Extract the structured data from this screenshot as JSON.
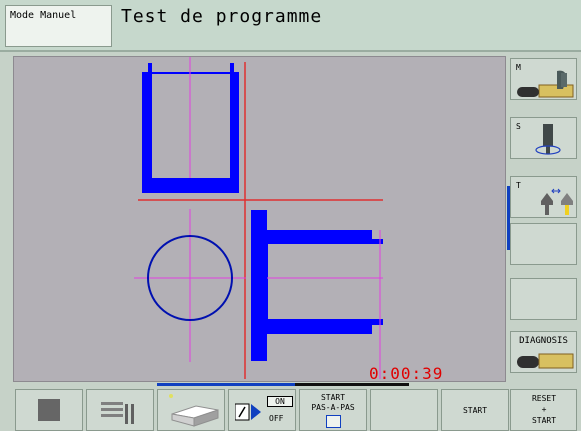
{
  "header": {
    "mode_label": "Mode Manuel",
    "title": "Test de programme"
  },
  "simulation": {
    "timer": "0:00:39"
  },
  "right_softkeys": [
    {
      "letter": "M",
      "icon": "spindle-machine-icon"
    },
    {
      "letter": "S",
      "icon": "spindle-speed-icon"
    },
    {
      "letter": "T",
      "icon": "tool-change-icon"
    },
    {
      "label": ""
    },
    {
      "label": ""
    },
    {
      "label": "DIAGNOSIS",
      "icon": "diagnosis-machine-icon"
    }
  ],
  "bottom_softkeys": {
    "stop_icon": "stop-square-icon",
    "tool_icon": "tool-table-icon",
    "workpiece_icon": "workpiece-block-icon",
    "block_skip": {
      "on_label": "ON",
      "off_label": "OFF",
      "icon": "block-skip-icon"
    },
    "start_single_line1": "START",
    "start_single_line2": "PAS-A-PAS",
    "start_label": "START",
    "reset_line1": "RESET",
    "reset_line2": "+",
    "reset_line3": "START"
  },
  "colors": {
    "part": "#0000ff",
    "axis_red": "#e03030",
    "axis_magenta": "#e040e0",
    "timer": "#e00000"
  }
}
